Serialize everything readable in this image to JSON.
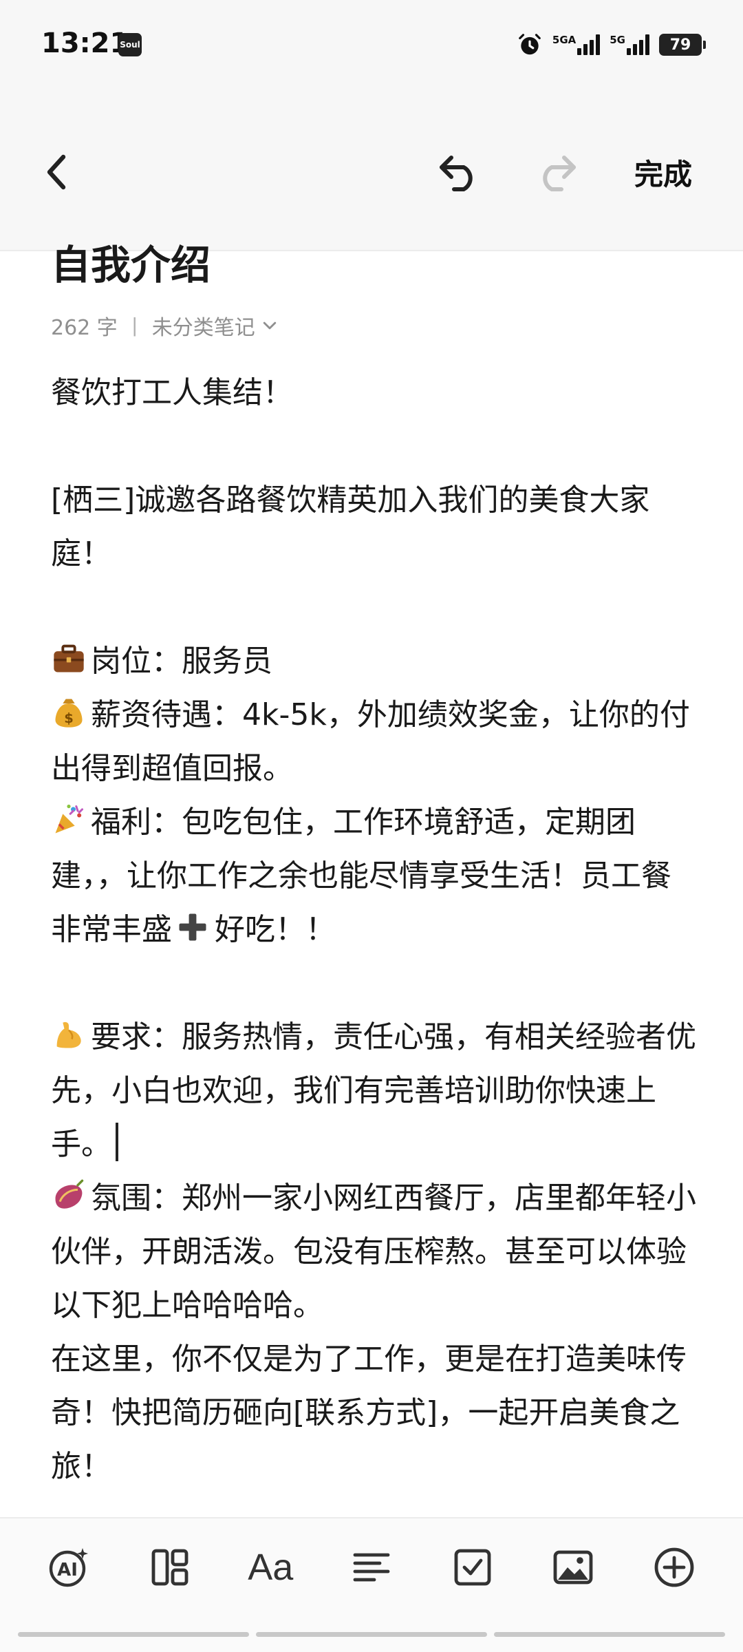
{
  "status_bar": {
    "time": "13:21",
    "app_icon_label": "Soul",
    "network_1": "5GA",
    "network_2": "5G",
    "battery": "79",
    "icons": [
      "alarm-icon",
      "signal-icon",
      "signal-icon",
      "battery-icon"
    ]
  },
  "toolbar": {
    "back_icon": "chevron-left-icon",
    "undo_icon": "undo-icon",
    "redo_icon": "redo-icon",
    "done_label": "完成"
  },
  "note": {
    "title": "自我介绍",
    "word_count": "262 字",
    "separator": "丨",
    "category": "未分类笔记",
    "paragraphs": [
      "餐饮打工人集结！",
      "",
      "[栖三]诚邀各路餐饮精英加入我们的美食大家庭！",
      "",
      "岗位：服务员",
      "薪资待遇：4k-5k，外加绩效奖金，让你的付出得到超值回报。",
      "福利：包吃包住，工作环境舒适，定期团建，，让你工作之余也能尽情享受生活！员工餐非常丰盛",
      "好吃！！",
      "",
      "要求：服务热情，责任心强，有相关经验者优先，小白也欢迎，我们有完善培训助你快速上手。",
      "氛围：郑州一家小网红西餐厅，店里都年轻小伙伴，开朗活泼。包没有压榨熬。甚至可以体验以下犯上哈哈哈哈。",
      "在这里，你不仅是为了工作，更是在打造美味传奇！快把简历砸向[联系方式]，一起开启美食之旅！"
    ],
    "emoji_icons": [
      "briefcase-icon",
      "money-bag-icon",
      "party-popper-icon",
      "plus-icon",
      "flexed-biceps-icon",
      "sweet-potato-icon"
    ]
  },
  "bottom_toolbar": {
    "font_label": "Aa",
    "tools": [
      "ai-icon",
      "layout-icon",
      "font-icon",
      "align-icon",
      "checkbox-icon",
      "image-icon",
      "add-icon"
    ]
  },
  "colors": {
    "header_bg": "#f7f7f7",
    "text": "#1a1a1a",
    "meta": "#8f8f8f",
    "redo_disabled": "#c4c4c4"
  }
}
